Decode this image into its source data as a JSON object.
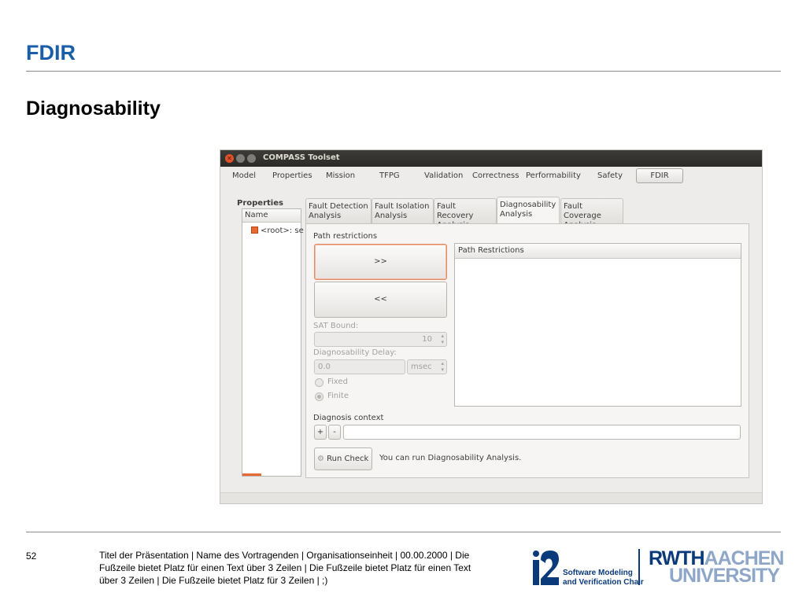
{
  "slide": {
    "title": "FDIR",
    "subtitle": "Diagnosability",
    "page_number": "52",
    "footer": "Titel der Präsentation  |  Name des Vortragenden  |  Organisationseinheit  |  00.00.2000  |  Die Fußzeile bietet Platz für einen Text über 3 Zeilen  |  Die Fußzeile bietet Platz für einen Text über 3 Zeilen  |  Die Fußzeile bietet Platz für 3 Zeilen  | ;)",
    "logo_chair": {
      "mark_text": "i2",
      "line1": "Software Modeling",
      "line2": "and Verification Chair"
    },
    "logo_rwth": {
      "rwth": "RWTH",
      "aachen": "AACHEN",
      "university": "UNIVERSITY"
    },
    "colors": {
      "title_blue": "#1a5ea8",
      "logo_blue": "#0b3a7a",
      "logo_light_blue": "#8ea7c8"
    }
  },
  "app": {
    "window_title": "COMPASS Toolset",
    "window_buttons": {
      "close_glyph": "✕",
      "minimize_glyph": "",
      "maximize_glyph": ""
    },
    "menu": [
      "Model",
      "Properties",
      "Mission",
      "TFPG",
      "Validation",
      "Correctness",
      "Performability",
      "Safety"
    ],
    "menu_selected": "FDIR",
    "properties": {
      "label": "Properties",
      "column_header": "Name",
      "row": "<root>: se",
      "row_checked": true
    },
    "tabs": [
      {
        "line1": "Fault Detection",
        "line2": "Analysis"
      },
      {
        "line1": "Fault Isolation",
        "line2": "Analysis"
      },
      {
        "line1": "Fault Recovery",
        "line2": "Analysis"
      },
      {
        "line1": "Diagnosability",
        "line2": "Analysis",
        "active": true
      },
      {
        "line1": "Fault Coverage",
        "line2": "Analysis"
      }
    ],
    "diagnosability": {
      "path_restrictions_label": "Path restrictions",
      "add_button": ">>",
      "remove_button": "<<",
      "path_list_header": "Path Restrictions",
      "sat_bound_label": "SAT Bound:",
      "sat_bound_value": "10",
      "delay_label": "Diagnosability Delay:",
      "delay_value": "0.0",
      "delay_unit": "msec",
      "radio_fixed": "Fixed",
      "radio_finite": "Finite",
      "radio_selected": "Finite",
      "context_label": "Diagnosis context",
      "context_add": "+",
      "context_remove": "-",
      "context_value": "",
      "run_button": "Run Check",
      "status": "You can run Diagnosability Analysis."
    },
    "colors": {
      "accent_orange": "#e86a33",
      "window_bg": "#edeceb",
      "titlebar": "#2b2a27"
    }
  }
}
